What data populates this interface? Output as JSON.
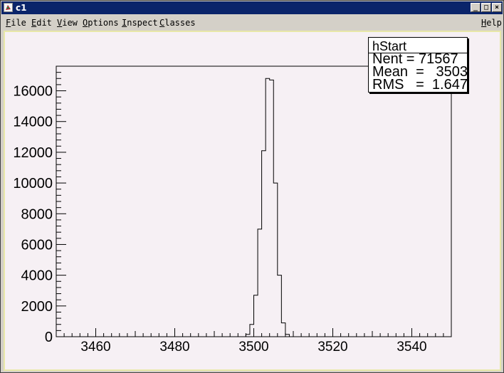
{
  "window": {
    "title": "c1",
    "controls": {
      "minimize": "_",
      "maximize": "□",
      "close": "×"
    }
  },
  "menu": {
    "items": [
      "File",
      "Edit",
      "View",
      "Options",
      "Inspect",
      "Classes"
    ],
    "help": "Help"
  },
  "stats": {
    "title": "hStart",
    "rows": [
      {
        "label": "Nent = 71567"
      },
      {
        "label": "Mean  =   3503"
      },
      {
        "label": "RMS   =  1.647"
      }
    ]
  },
  "chart_data": {
    "type": "bar",
    "xlim": [
      3450,
      3550
    ],
    "ylim": [
      0,
      17600
    ],
    "xticks": [
      3460,
      3480,
      3500,
      3520,
      3540
    ],
    "yticks": [
      0,
      2000,
      4000,
      6000,
      8000,
      10000,
      12000,
      14000,
      16000
    ],
    "bin_width": 1,
    "bins_x": [
      3498,
      3499,
      3500,
      3501,
      3502,
      3503,
      3504,
      3505,
      3506,
      3507,
      3508
    ],
    "values": [
      150,
      800,
      2700,
      7000,
      12100,
      16800,
      16700,
      10000,
      4000,
      900,
      150
    ],
    "colors": {
      "line": "#000000",
      "background": "#f6f0f4"
    }
  }
}
